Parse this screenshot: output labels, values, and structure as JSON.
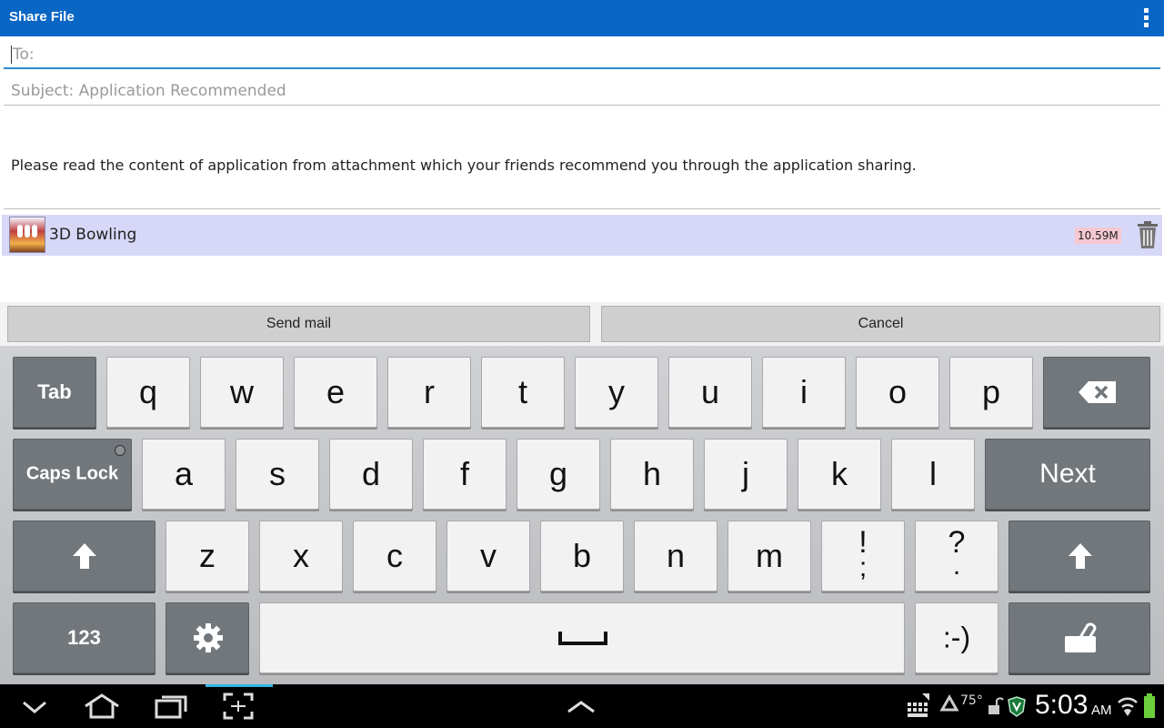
{
  "app": {
    "title": "Share File"
  },
  "form": {
    "to_placeholder": "To:",
    "subject": "Subject: Application Recommended",
    "body": "Please read the content of application from attachment which your friends recommend you through the application sharing."
  },
  "attachment": {
    "name": "3D Bowling",
    "size": "10.59M"
  },
  "buttons": {
    "send": "Send mail",
    "cancel": "Cancel"
  },
  "keyboard": {
    "row1": [
      "Tab",
      "q",
      "w",
      "e",
      "r",
      "t",
      "y",
      "u",
      "i",
      "o",
      "p"
    ],
    "row2": [
      "Caps Lock",
      "a",
      "s",
      "d",
      "f",
      "g",
      "h",
      "j",
      "k",
      "l",
      "Next"
    ],
    "row3": [
      "z",
      "x",
      "c",
      "v",
      "b",
      "n",
      "m"
    ],
    "punct1": {
      "top": "!",
      "bottom": ";"
    },
    "punct2": {
      "top": "?",
      "bottom": "."
    },
    "row4": {
      "num": "123",
      "smiley": ":-)"
    }
  },
  "status": {
    "temperature": "75°",
    "time": "5:03",
    "ampm": "AM"
  },
  "colors": {
    "titlebar": "#0a66c4",
    "attachment_bg": "#d7d8f7",
    "size_badge": "#f5c8d2",
    "nav_accent": "#33b5e5"
  }
}
